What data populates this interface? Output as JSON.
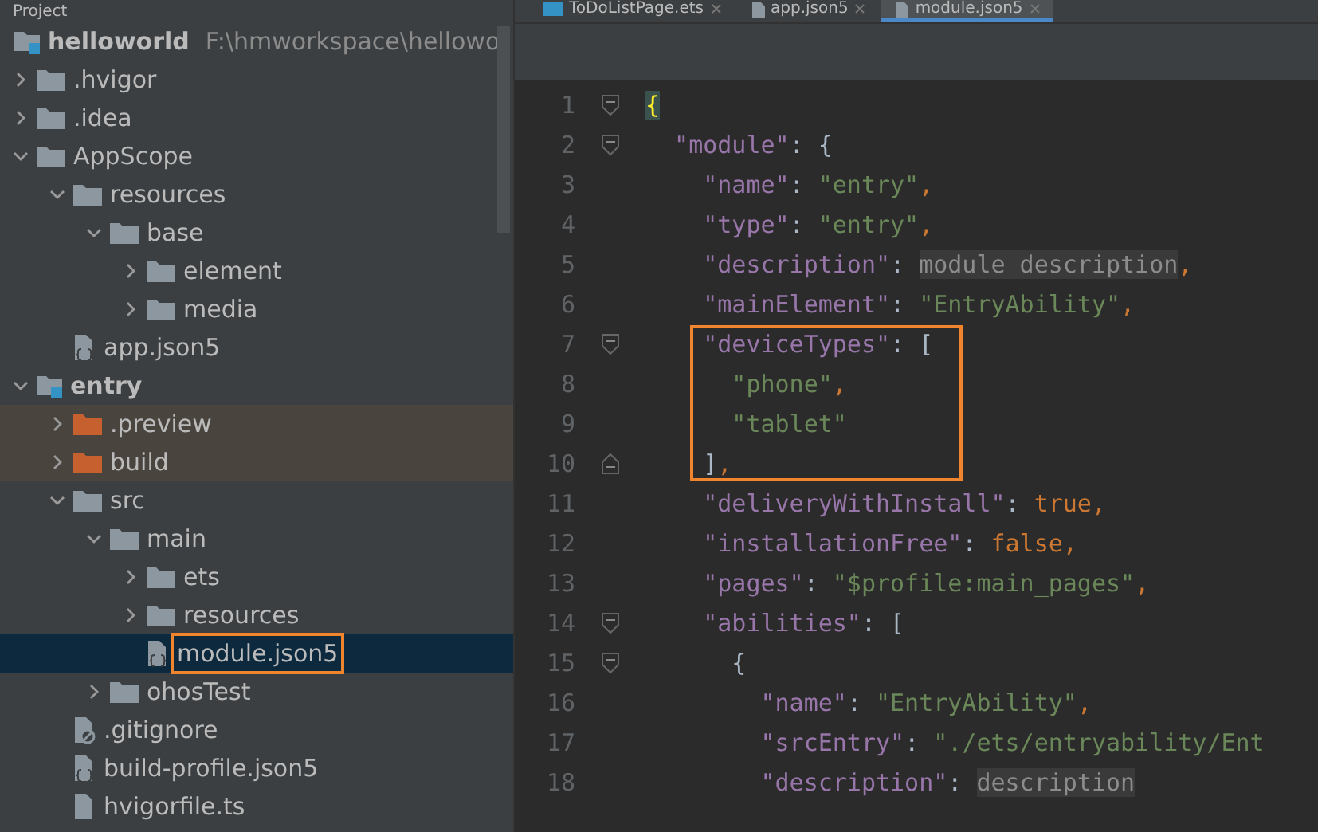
{
  "project_panel": {
    "title": "Project",
    "root": {
      "name": "helloworld",
      "path": "F:\\hmworkspace\\hellowo",
      "kind": "module",
      "children": [
        {
          "name": ".hvigor",
          "kind": "folder",
          "expanded": false
        },
        {
          "name": ".idea",
          "kind": "folder",
          "expanded": false
        },
        {
          "name": "AppScope",
          "kind": "folder",
          "expanded": true,
          "children": [
            {
              "name": "resources",
              "kind": "folder",
              "expanded": true,
              "children": [
                {
                  "name": "base",
                  "kind": "folder",
                  "expanded": true,
                  "children": [
                    {
                      "name": "element",
                      "kind": "folder",
                      "expanded": false
                    },
                    {
                      "name": "media",
                      "kind": "folder",
                      "expanded": false
                    }
                  ]
                }
              ]
            },
            {
              "name": "app.json5",
              "kind": "json-file"
            }
          ]
        },
        {
          "name": "entry",
          "kind": "module",
          "expanded": true,
          "children": [
            {
              "name": ".preview",
              "kind": "folder",
              "expanded": false,
              "excluded": true
            },
            {
              "name": "build",
              "kind": "folder",
              "expanded": false,
              "excluded": true
            },
            {
              "name": "src",
              "kind": "folder",
              "expanded": true,
              "children": [
                {
                  "name": "main",
                  "kind": "folder",
                  "expanded": true,
                  "children": [
                    {
                      "name": "ets",
                      "kind": "folder",
                      "expanded": false
                    },
                    {
                      "name": "resources",
                      "kind": "folder",
                      "expanded": false
                    },
                    {
                      "name": "module.json5",
                      "kind": "json-file",
                      "selected": true,
                      "outlined": true
                    }
                  ]
                },
                {
                  "name": "ohosTest",
                  "kind": "folder",
                  "expanded": false
                }
              ]
            },
            {
              "name": ".gitignore",
              "kind": "ignore-file"
            },
            {
              "name": "build-profile.json5",
              "kind": "json-file"
            },
            {
              "name": "hvigorfile.ts",
              "kind": "ts-file"
            }
          ]
        }
      ]
    }
  },
  "editor": {
    "tabs": [
      {
        "label": "ToDoListPage.ets",
        "kind": "ets",
        "selected": false
      },
      {
        "label": "app.json5",
        "kind": "json",
        "selected": false
      },
      {
        "label": "module.json5",
        "kind": "json",
        "selected": true
      }
    ],
    "lines": [
      {
        "number": "1",
        "fold_start": true,
        "tokens": [
          {
            "kind": "brace-match",
            "text": "{"
          }
        ]
      },
      {
        "number": "2",
        "fold_start": true,
        "tokens": [
          {
            "kind": "key",
            "text": "  \"module\""
          },
          {
            "kind": "punct",
            "text": ": {"
          }
        ]
      },
      {
        "number": "3",
        "tokens": [
          {
            "kind": "key",
            "text": "    \"name\""
          },
          {
            "kind": "punct",
            "text": ": "
          },
          {
            "kind": "string",
            "text": "\"entry\""
          },
          {
            "kind": "keyword",
            "text": ","
          }
        ]
      },
      {
        "number": "4",
        "tokens": [
          {
            "kind": "key",
            "text": "    \"type\""
          },
          {
            "kind": "punct",
            "text": ": "
          },
          {
            "kind": "string",
            "text": "\"entry\""
          },
          {
            "kind": "keyword",
            "text": ","
          }
        ]
      },
      {
        "number": "5",
        "tokens": [
          {
            "kind": "key",
            "text": "    \"description\""
          },
          {
            "kind": "punct",
            "text": ": "
          },
          {
            "kind": "folded",
            "text": "module description"
          },
          {
            "kind": "keyword",
            "text": ","
          }
        ]
      },
      {
        "number": "6",
        "tokens": [
          {
            "kind": "key",
            "text": "    \"mainElement\""
          },
          {
            "kind": "punct",
            "text": ": "
          },
          {
            "kind": "string",
            "text": "\"EntryAbility\""
          },
          {
            "kind": "keyword",
            "text": ","
          }
        ]
      },
      {
        "number": "7",
        "fold_start": true,
        "boxed": true,
        "tokens": [
          {
            "kind": "key",
            "text": "    \"deviceTypes\""
          },
          {
            "kind": "punct",
            "text": ": ["
          }
        ]
      },
      {
        "number": "8",
        "boxed": true,
        "tokens": [
          {
            "kind": "string",
            "text": "      \"phone\""
          },
          {
            "kind": "keyword",
            "text": ","
          }
        ]
      },
      {
        "number": "9",
        "boxed": true,
        "tokens": [
          {
            "kind": "string",
            "text": "      \"tablet\""
          }
        ]
      },
      {
        "number": "10",
        "fold_end": true,
        "boxed": true,
        "tokens": [
          {
            "kind": "punct",
            "text": "    ]"
          },
          {
            "kind": "keyword",
            "text": ","
          }
        ]
      },
      {
        "number": "11",
        "tokens": [
          {
            "kind": "key",
            "text": "    \"deliveryWithInstall\""
          },
          {
            "kind": "punct",
            "text": ": "
          },
          {
            "kind": "keyword",
            "text": "true,"
          }
        ]
      },
      {
        "number": "12",
        "tokens": [
          {
            "kind": "key",
            "text": "    \"installationFree\""
          },
          {
            "kind": "punct",
            "text": ": "
          },
          {
            "kind": "keyword",
            "text": "false,"
          }
        ]
      },
      {
        "number": "13",
        "tokens": [
          {
            "kind": "key",
            "text": "    \"pages\""
          },
          {
            "kind": "punct",
            "text": ": "
          },
          {
            "kind": "string",
            "text": "\"$profile:main_pages\""
          },
          {
            "kind": "keyword",
            "text": ","
          }
        ]
      },
      {
        "number": "14",
        "fold_start": true,
        "tokens": [
          {
            "kind": "key",
            "text": "    \"abilities\""
          },
          {
            "kind": "punct",
            "text": ": ["
          }
        ]
      },
      {
        "number": "15",
        "fold_start": true,
        "tokens": [
          {
            "kind": "punct",
            "text": "      {"
          }
        ]
      },
      {
        "number": "16",
        "tokens": [
          {
            "kind": "key",
            "text": "        \"name\""
          },
          {
            "kind": "punct",
            "text": ": "
          },
          {
            "kind": "string",
            "text": "\"EntryAbility\""
          },
          {
            "kind": "keyword",
            "text": ","
          }
        ]
      },
      {
        "number": "17",
        "tokens": [
          {
            "kind": "key",
            "text": "        \"srcEntry\""
          },
          {
            "kind": "punct",
            "text": ": "
          },
          {
            "kind": "string",
            "text": "\"./ets/entryability/Ent"
          }
        ]
      },
      {
        "number": "18",
        "tokens": [
          {
            "kind": "key",
            "text": "        \"description\""
          },
          {
            "kind": "punct",
            "text": ": "
          },
          {
            "kind": "folded",
            "text": "description"
          }
        ]
      }
    ]
  }
}
